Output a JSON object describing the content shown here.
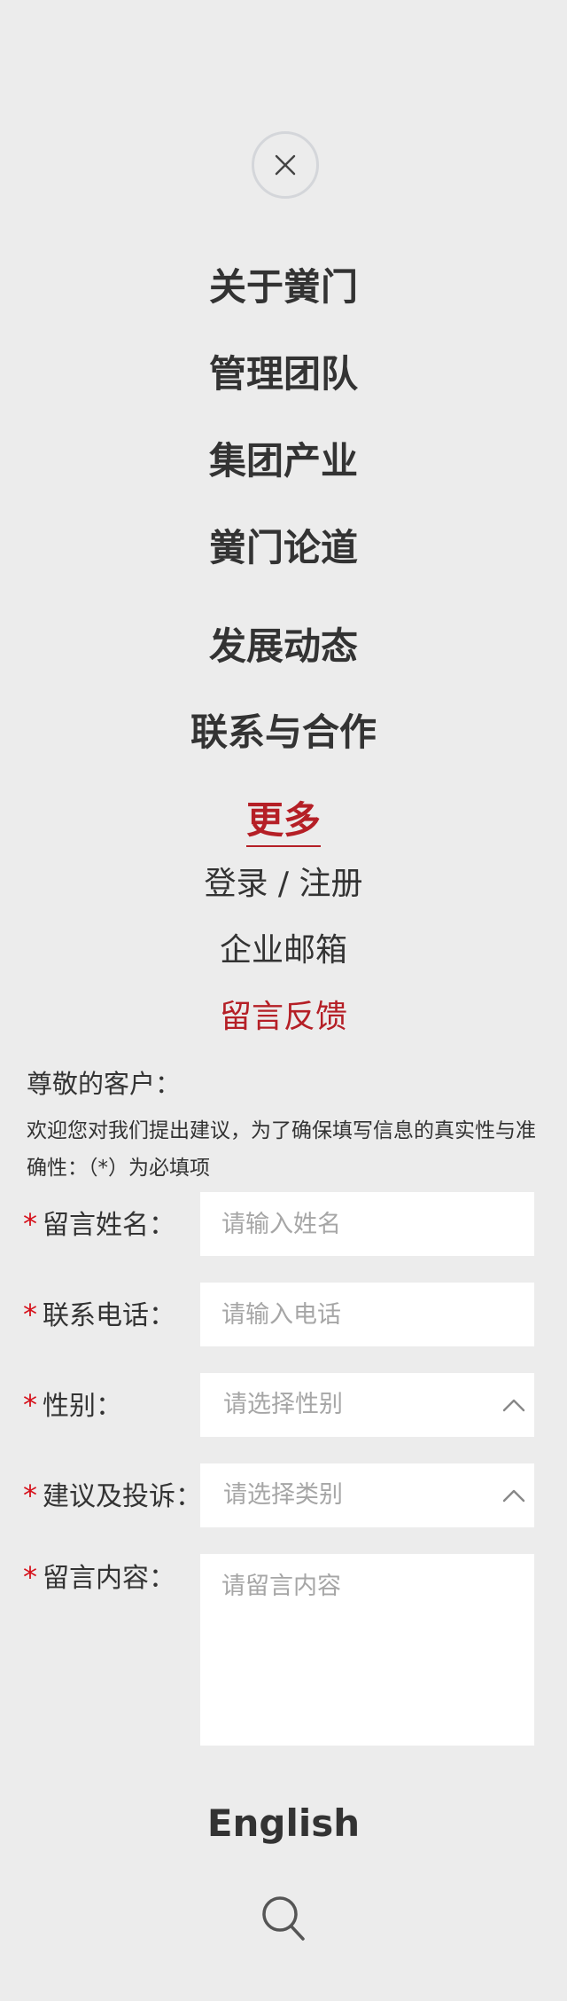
{
  "icons": {
    "close": "close-icon",
    "chevron": "chevron-up-icon",
    "search": "search-icon"
  },
  "colors": {
    "background": "#ececec",
    "accent": "#b51f26",
    "required_star": "#d6101a",
    "text": "#333333",
    "placeholder": "#a6a6a6"
  },
  "nav": {
    "items": [
      "关于黉门",
      "管理团队",
      "集团产业",
      "黉门论道",
      "发展动态",
      "联系与合作"
    ],
    "more": "更多"
  },
  "links": {
    "login": "登录 / 注册",
    "mail": "企业邮箱",
    "feedback": "留言反馈"
  },
  "form": {
    "greeting": "尊敬的客户：",
    "note": "欢迎您对我们提出建议，为了确保填写信息的真实性与准确性：（*）为必填项",
    "required_mark": "*",
    "name_label": "留言姓名：",
    "name_placeholder": "请输入姓名",
    "phone_label": "联系电话：",
    "phone_placeholder": "请输入电话",
    "gender_label": "性别：",
    "gender_value": "请选择性别",
    "type_label": "建议及投诉：",
    "type_value": "请选择类别",
    "content_label": "留言内容：",
    "content_placeholder": "请留言内容"
  },
  "footer": {
    "english": "English"
  }
}
